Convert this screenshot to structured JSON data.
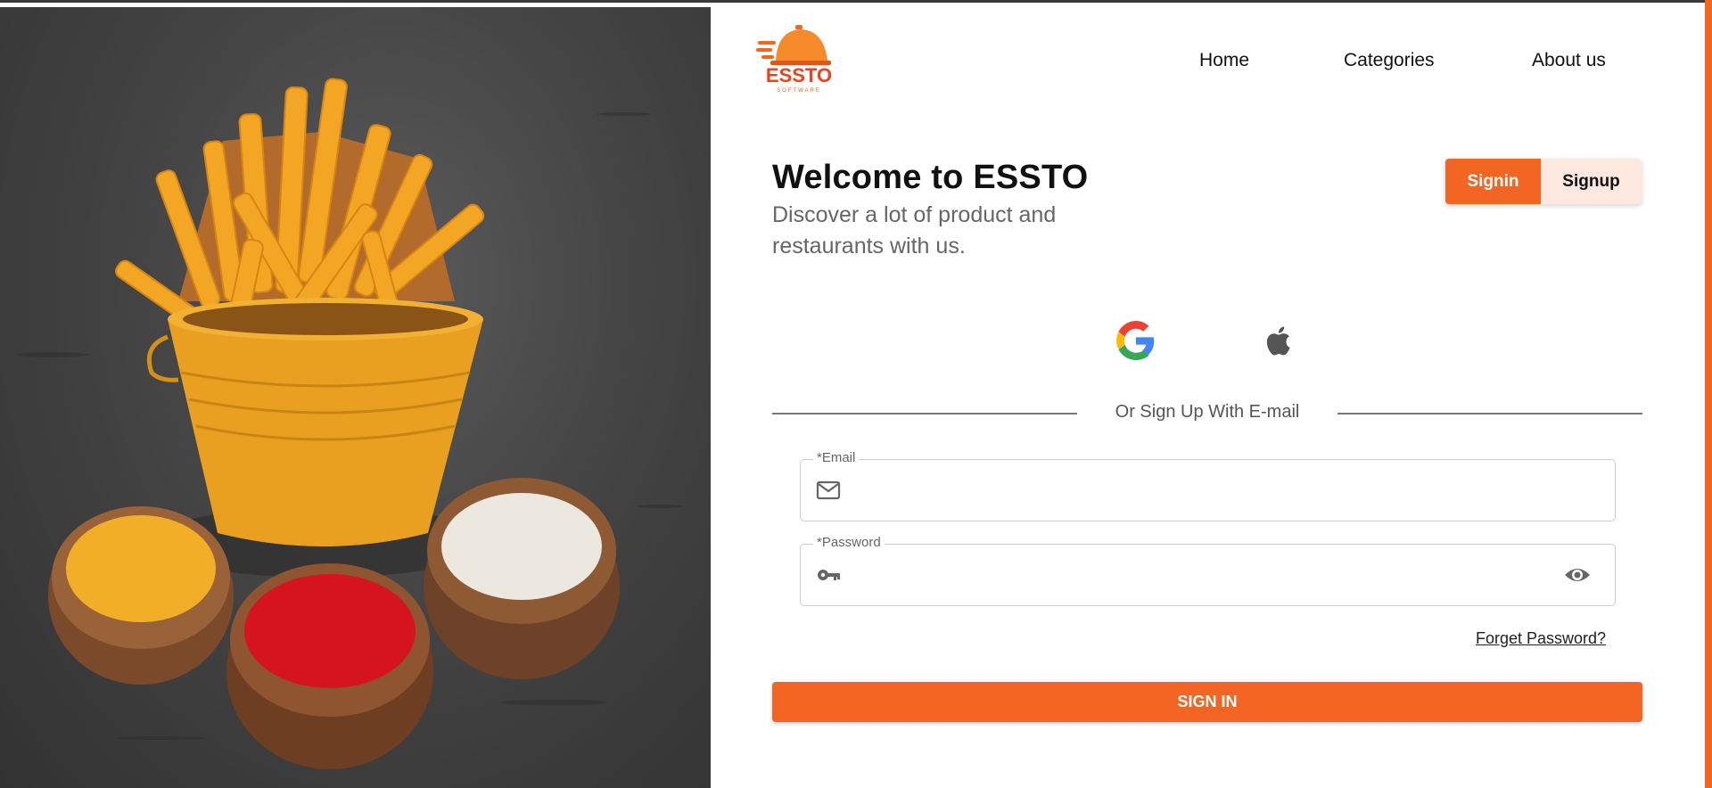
{
  "brand": {
    "logo_text": "ESSTO",
    "logo_sub": "SOFTWARE",
    "accent_color": "#f26522"
  },
  "nav": {
    "home": "Home",
    "categories": "Categories",
    "about": "About us"
  },
  "header": {
    "title": "Welcome to ESSTO",
    "subtitle": "Discover a lot of product and restaurants with us."
  },
  "auth_toggle": {
    "signin": "Signin",
    "signup": "Signup",
    "active": "Signin"
  },
  "social": {
    "google_icon": "google-icon",
    "apple_icon": "apple-icon"
  },
  "divider": {
    "text": "Or Sign Up With E-mail"
  },
  "form": {
    "email_label": "*Email",
    "email_value": "",
    "password_label": "*Password",
    "password_value": "",
    "forgot": "Forget Password?",
    "submit": "SIGN IN"
  }
}
